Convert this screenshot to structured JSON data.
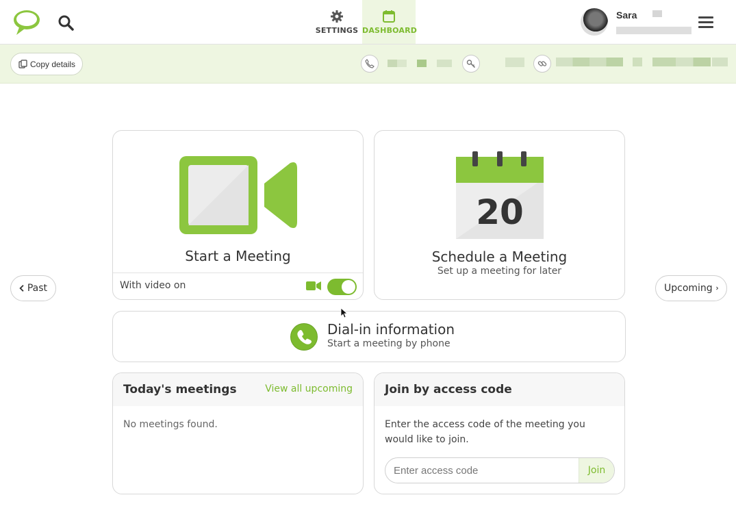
{
  "header": {
    "logo_icon": "speech-bubble-logo",
    "search_icon": "search-icon",
    "tabs": [
      {
        "label": "SETTINGS",
        "icon": "gear-icon",
        "active": false
      },
      {
        "label": "DASHBOARD",
        "icon": "calendar-icon",
        "active": true
      }
    ],
    "user": {
      "name": "Sara"
    },
    "menu_icon": "hamburger-icon"
  },
  "infobar": {
    "copy_label": "Copy details",
    "icons": [
      "phone-icon",
      "key-icon",
      "link-icon"
    ]
  },
  "start_meeting": {
    "title": "Start a Meeting",
    "video_label": "With video on",
    "video_on": true
  },
  "schedule_meeting": {
    "title": "Schedule a Meeting",
    "subtitle": "Set up a meeting for later",
    "calendar_day": "20"
  },
  "nav_buttons": {
    "past": "Past",
    "upcoming": "Upcoming"
  },
  "dialin": {
    "title": "Dial-in information",
    "subtitle": "Start a meeting by phone"
  },
  "today": {
    "title": "Today's meetings",
    "link": "View all upcoming",
    "empty": "No meetings found."
  },
  "join": {
    "title": "Join by access code",
    "text": "Enter the access code of the meeting you would like to join.",
    "placeholder": "Enter access code",
    "button": "Join"
  },
  "colors": {
    "accent": "#7dbb2f",
    "accent_light": "#eef6e1"
  }
}
